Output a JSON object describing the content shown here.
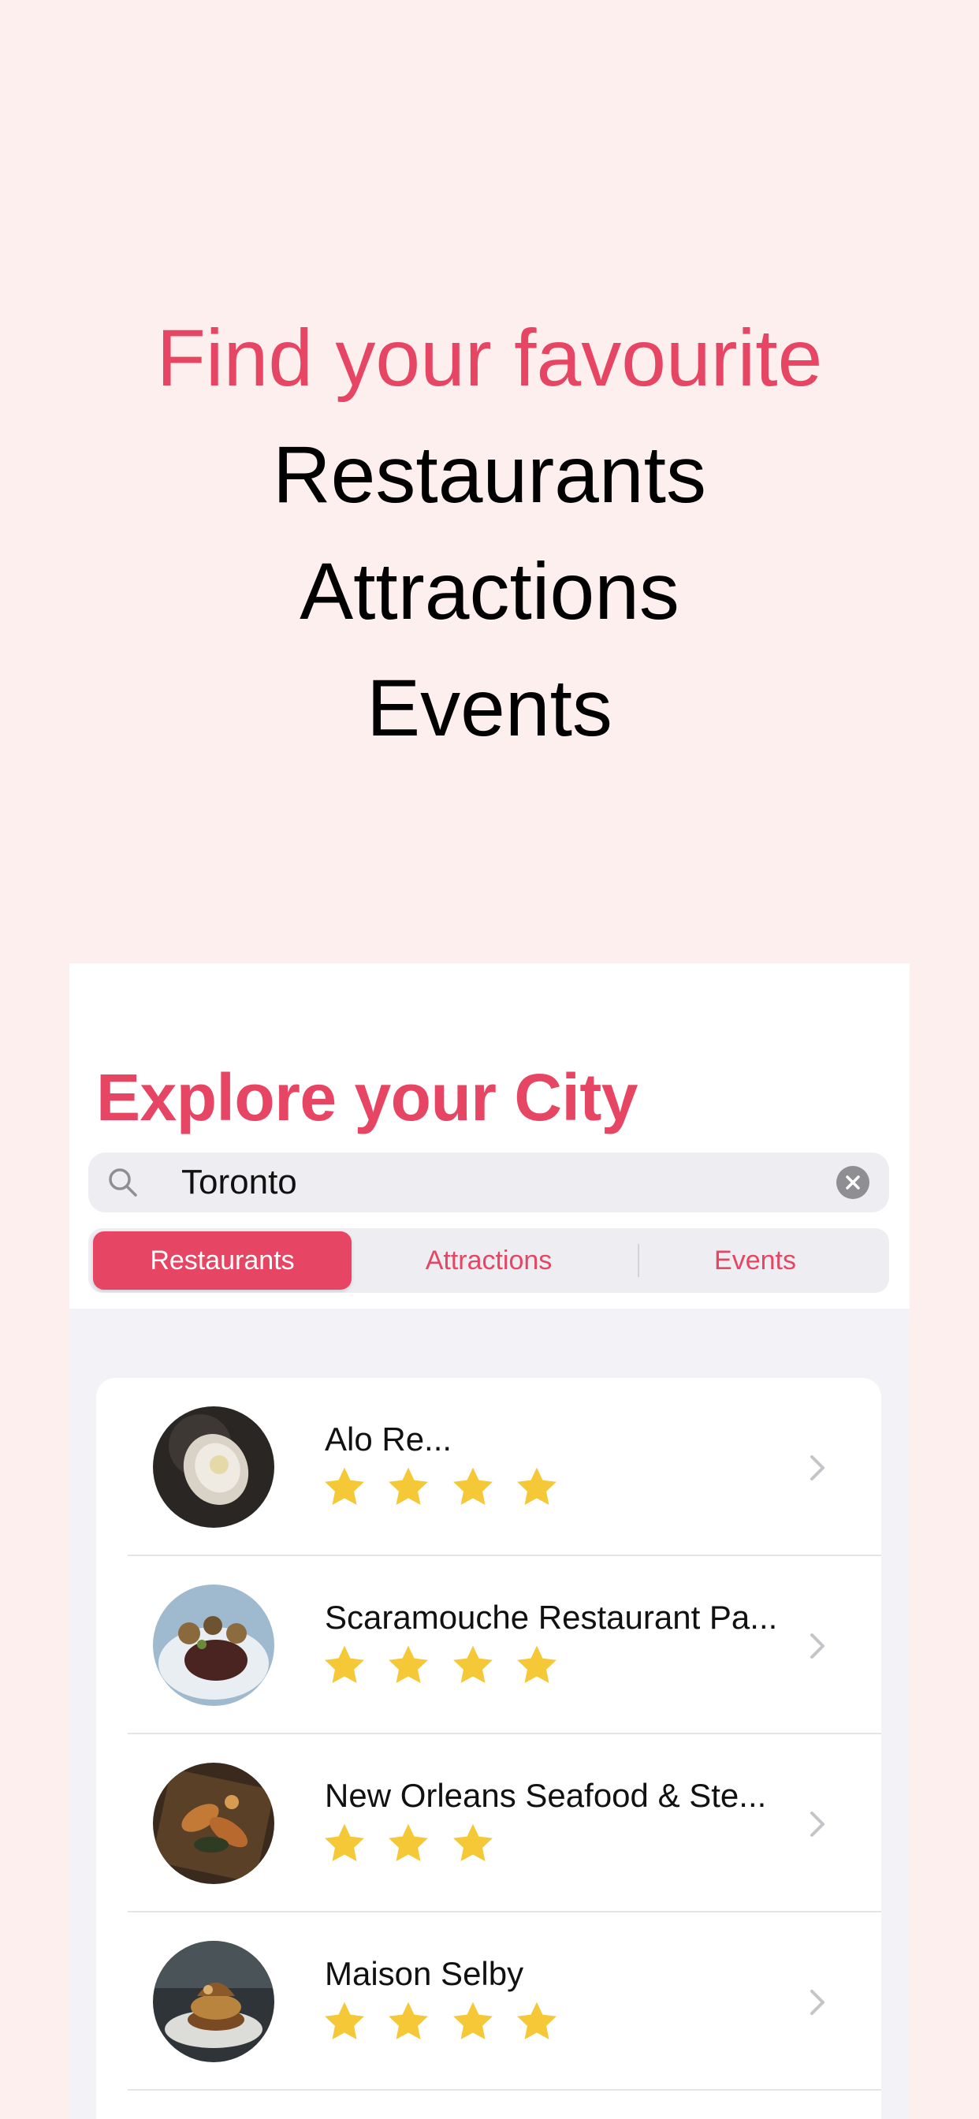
{
  "hero": {
    "line1": "Find your favourite",
    "line2": "Restaurants",
    "line3": "Attractions",
    "line4": "Events"
  },
  "app": {
    "title": "Explore your City",
    "search": {
      "value": "Toronto"
    },
    "segments": [
      "Restaurants",
      "Attractions",
      "Events"
    ],
    "selected_segment": "Restaurants",
    "items": [
      {
        "name": "Alo Re...",
        "rating": 4,
        "image": "plated dish"
      },
      {
        "name": "Scaramouche Restaurant Pa...",
        "rating": 4,
        "image": "plated dish"
      },
      {
        "name": "New Orleans Seafood & Ste...",
        "rating": 3,
        "image": "seafood platter"
      },
      {
        "name": "Maison Selby",
        "rating": 4,
        "image": "burger"
      }
    ]
  },
  "colors": {
    "accent": "#E64663",
    "background": "#FDEFEE",
    "star": "#F5C838"
  },
  "icons": [
    "search-icon",
    "clear-icon",
    "star-icon",
    "chevron-right-icon"
  ]
}
